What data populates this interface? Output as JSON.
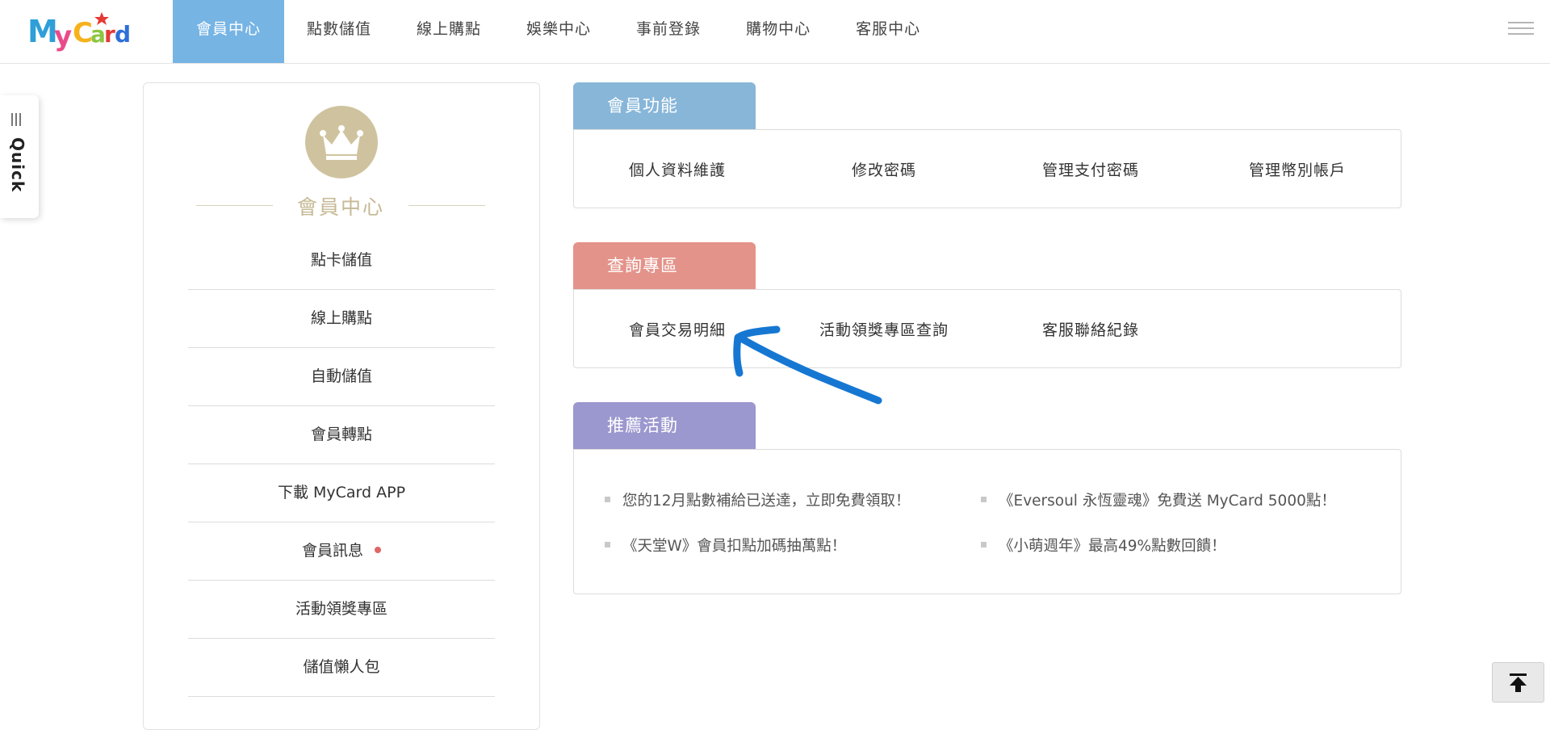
{
  "brand": {
    "logo_text": "MyCard"
  },
  "nav": {
    "items": [
      {
        "label": "會員中心",
        "active": true
      },
      {
        "label": "點數儲值"
      },
      {
        "label": "線上購點"
      },
      {
        "label": "娛樂中心"
      },
      {
        "label": "事前登錄"
      },
      {
        "label": "購物中心"
      },
      {
        "label": "客服中心"
      }
    ]
  },
  "quick": {
    "label": "Quick"
  },
  "sidebar": {
    "title": "會員中心",
    "items": [
      {
        "label": "點卡儲值"
      },
      {
        "label": "線上購點"
      },
      {
        "label": "自動儲值"
      },
      {
        "label": "會員轉點"
      },
      {
        "label": "下載 MyCard APP"
      },
      {
        "label": "會員訊息",
        "has_notification": true
      },
      {
        "label": "活動領獎專區"
      },
      {
        "label": "儲值懶人包"
      }
    ]
  },
  "sections": {
    "member_functions": {
      "title": "會員功能",
      "color": "#88b6d9",
      "links": [
        "個人資料維護",
        "修改密碼",
        "管理支付密碼",
        "管理幣別帳戶"
      ]
    },
    "query": {
      "title": "查詢專區",
      "color": "#e4938a",
      "links": [
        "會員交易明細",
        "活動領獎專區查詢",
        "客服聯絡紀錄"
      ]
    },
    "recommend": {
      "title": "推薦活動",
      "color": "#9b97cf",
      "promos": [
        "您的12月點數補給已送達，立即免費領取！",
        "《Eversoul 永恆靈魂》免費送 MyCard 5000點！",
        "《天堂W》會員扣點加碼抽萬點！",
        "《小萌週年》最高49%點數回饋！"
      ]
    }
  },
  "colors": {
    "accent": "#76b4e4",
    "gold": "#cfc39f",
    "annotation_arrow": "#1677d2"
  }
}
